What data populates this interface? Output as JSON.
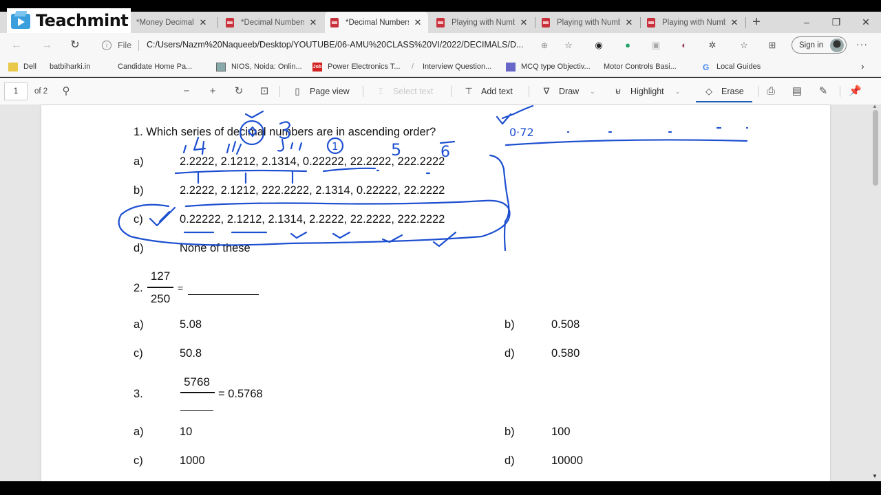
{
  "overlay": {
    "brand": "Teachmint"
  },
  "browser": {
    "tabs": [
      {
        "label": "*Money Decimals",
        "active": false,
        "icon": "pdf-icon"
      },
      {
        "label": "*Decimal Numbers",
        "active": false,
        "icon": "pdf-icon"
      },
      {
        "label": "*Decimal Numbers",
        "active": true,
        "icon": "pdf-icon"
      },
      {
        "label": "Playing with Numbers",
        "active": false,
        "icon": "pdf-icon"
      },
      {
        "label": "Playing with Numbers",
        "active": false,
        "icon": "pdf-icon"
      },
      {
        "label": "Playing with Numbers",
        "active": false,
        "icon": "pdf-icon"
      }
    ],
    "tab_close": "✕",
    "new_tab": "+",
    "window": {
      "minimize": "–",
      "restore": "❐",
      "close": "✕"
    },
    "address": {
      "scheme_label": "File",
      "url": "C:/Users/Nazm%20Naqueeb/Desktop/YOUTUBE/06-AMU%20CLASS%20VI/2022/DECIMALS/D..."
    },
    "sign_in_label": "Sign in",
    "more": "···",
    "bookmarks": [
      {
        "label": "Dell",
        "icon": "folder-icon"
      },
      {
        "label": "batbiharki.in",
        "icon": "page-icon"
      },
      {
        "label": "Candidate Home Pa...",
        "icon": "page-icon"
      },
      {
        "label": "NIOS, Noida: Onlin...",
        "icon": "image-icon"
      },
      {
        "label": "Power Electronics T...",
        "icon": "job-icon"
      },
      {
        "label": "Interview Question...",
        "icon": "slash-icon"
      },
      {
        "label": "MCQ type Objectiv...",
        "icon": "mcq-icon"
      },
      {
        "label": "Motor Controls Basi...",
        "icon": "page-icon"
      },
      {
        "label": "Local Guides",
        "icon": "google-icon"
      }
    ]
  },
  "pdf_toolbar": {
    "page_current": "1",
    "page_total": "of 2",
    "page_view": "Page view",
    "select_text": "Select text",
    "add_text": "Add text",
    "draw": "Draw",
    "highlight": "Highlight",
    "erase": "Erase",
    "active_tool": "Erase"
  },
  "document": {
    "q1": {
      "question": "1. Which series of decimal numbers are in ascending order?",
      "options": [
        {
          "label": "a)",
          "text": "2.2222, 2.1212, 2.1314, 0.22222, 22.2222, 222.2222"
        },
        {
          "label": "b)",
          "text": "2.2222, 2.1212, 222.2222, 2.1314, 0.22222, 22.2222"
        },
        {
          "label": "c)",
          "text": "0.22222, 2.1212, 2.1314, 2.2222, 22.2222, 222.2222"
        },
        {
          "label": "d)",
          "text": "None of these"
        }
      ]
    },
    "q2": {
      "number": "2.",
      "numerator": "127",
      "denominator": "250",
      "equals": "=",
      "options": [
        {
          "label": "a)",
          "text": "5.08"
        },
        {
          "label": "b)",
          "text": "0.508"
        },
        {
          "label": "c)",
          "text": "50.8"
        },
        {
          "label": "d)",
          "text": "0.580"
        }
      ]
    },
    "q3": {
      "number": "3.",
      "numerator": "5768",
      "rhs": "= 0.5768",
      "options": [
        {
          "label": "a)",
          "text": "10"
        },
        {
          "label": "b)",
          "text": "100"
        },
        {
          "label": "c)",
          "text": "1000"
        },
        {
          "label": "d)",
          "text": "10000"
        }
      ]
    }
  },
  "annotations": {
    "ink_color": "#1d4fd0",
    "side_note": "0·72",
    "circled_numbers": [
      "1",
      "5",
      "6"
    ]
  }
}
